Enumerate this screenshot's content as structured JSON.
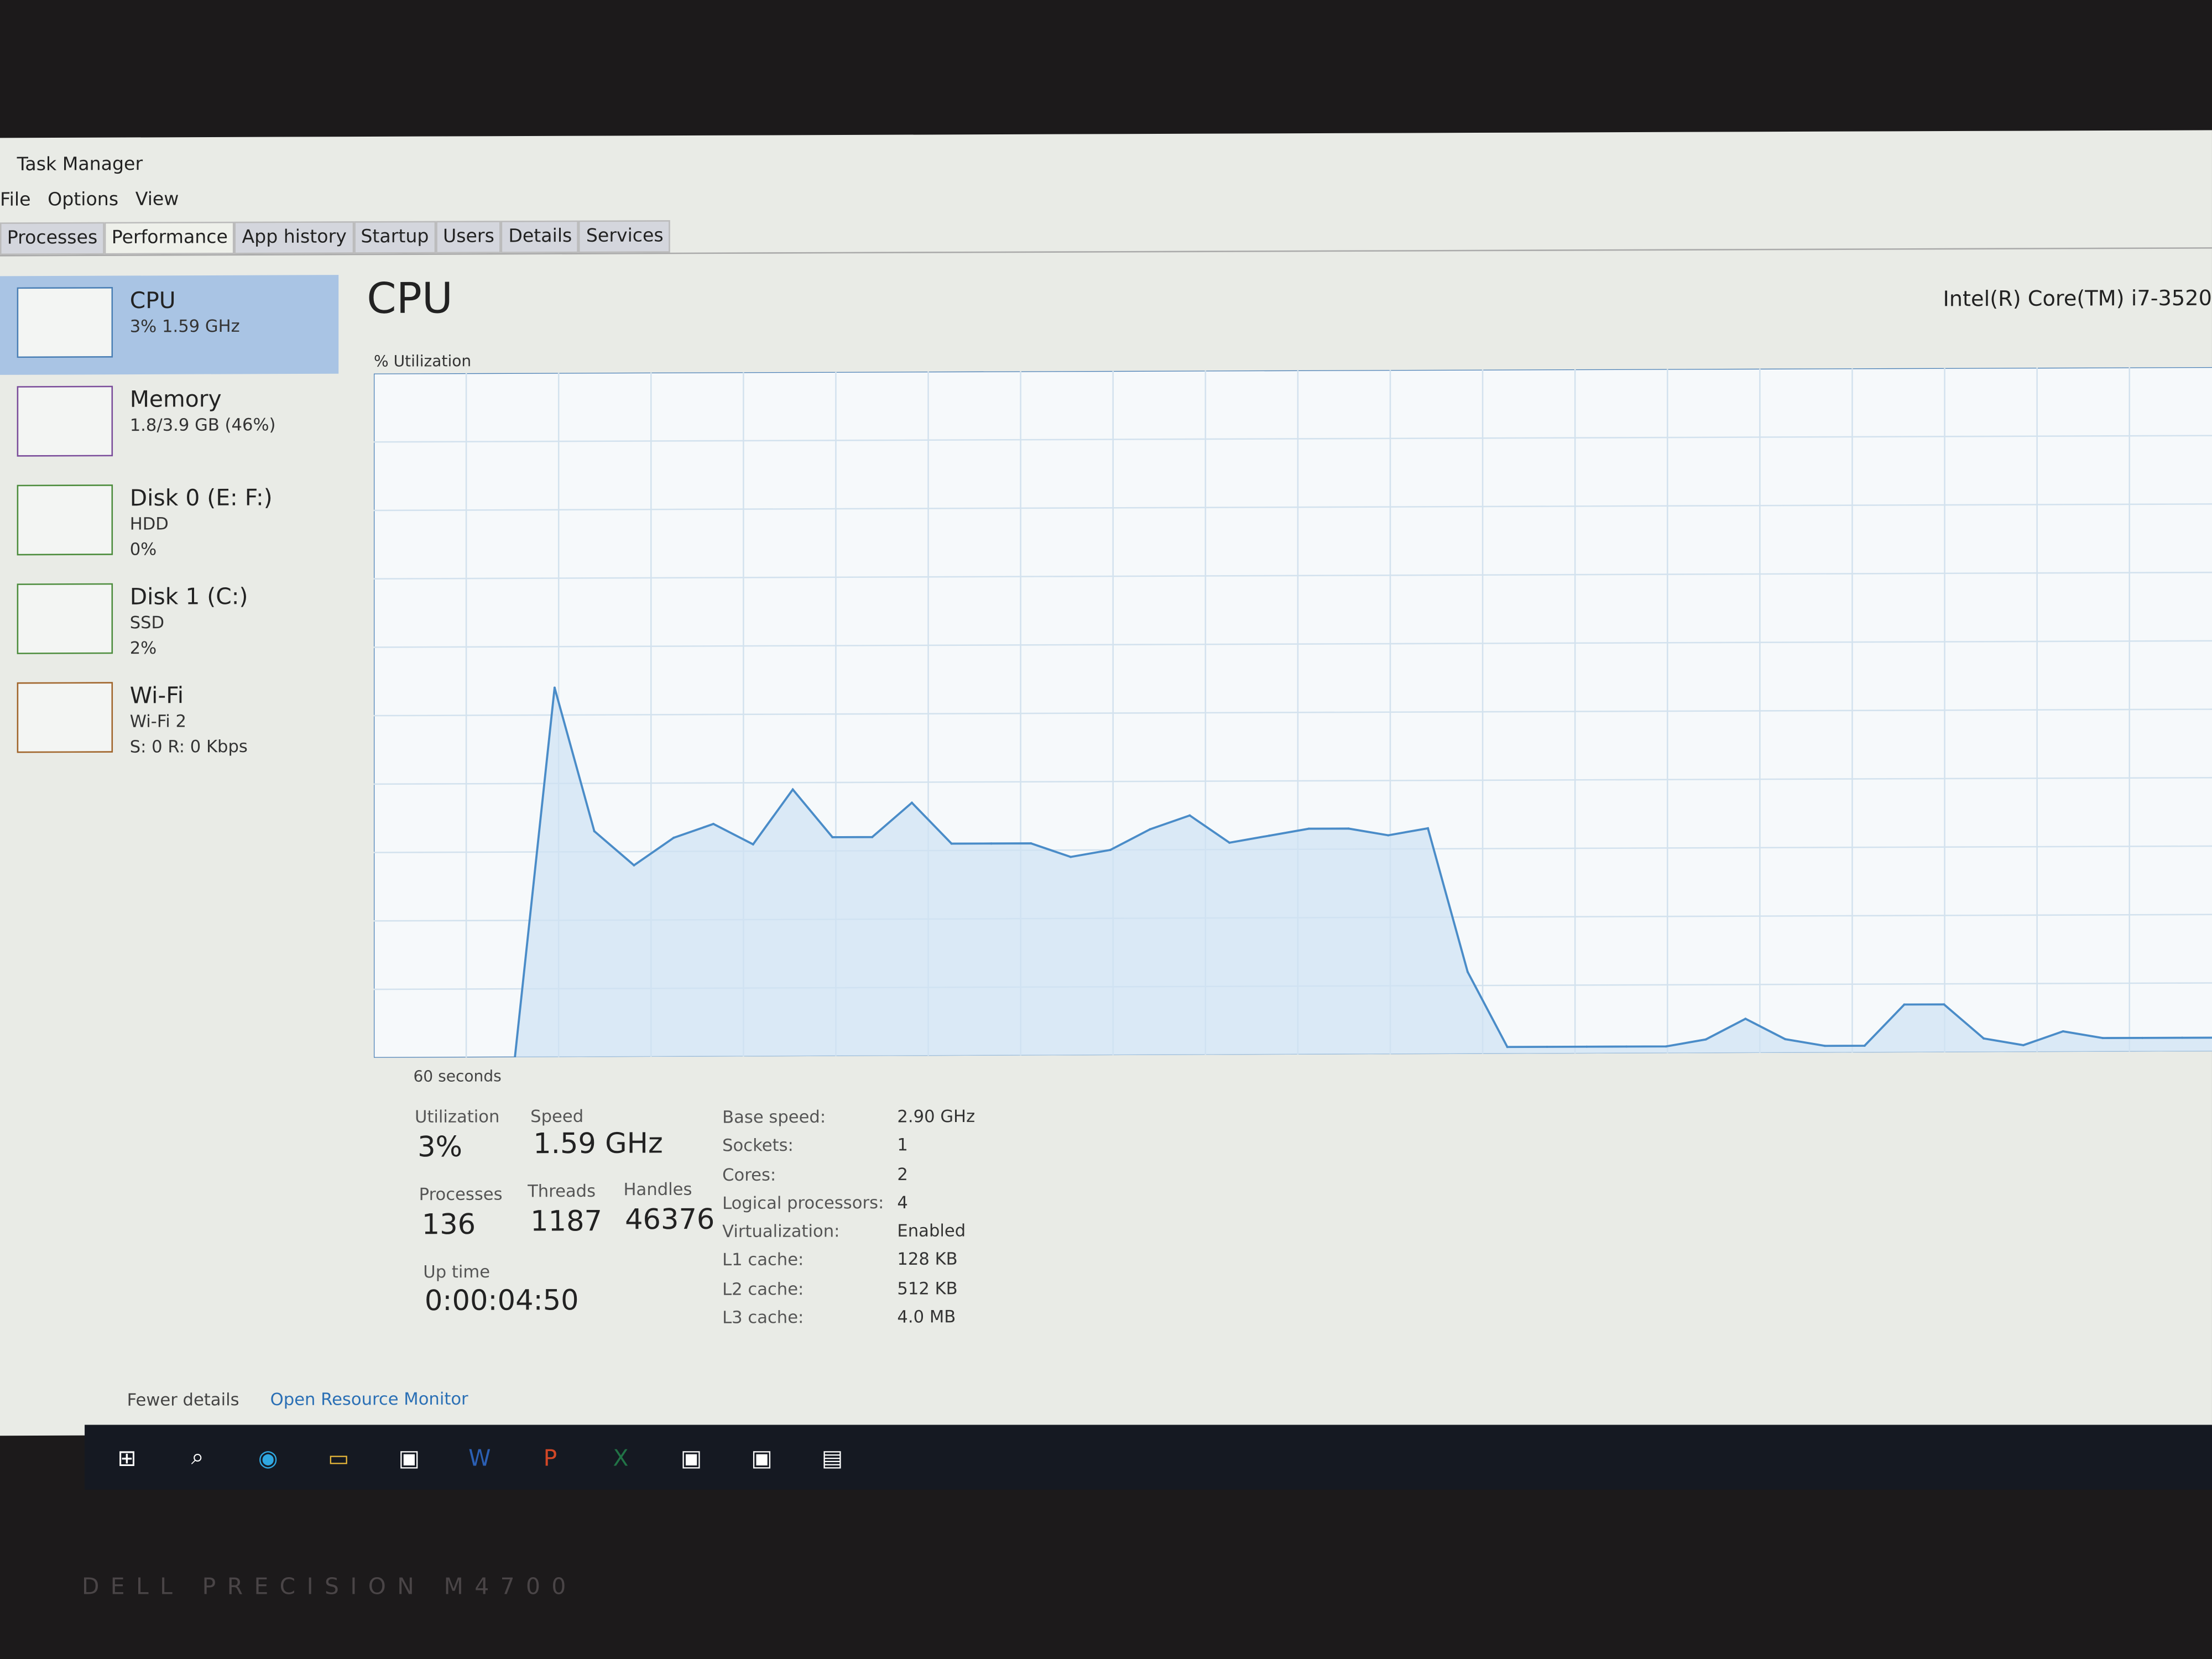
{
  "window": {
    "title": "Task Manager"
  },
  "menu": [
    "File",
    "Options",
    "View"
  ],
  "tabs": [
    "Processes",
    "Performance",
    "App history",
    "Startup",
    "Users",
    "Details",
    "Services"
  ],
  "active_tab": "Performance",
  "sidebar": [
    {
      "name": "CPU",
      "line1": "3%  1.59 GHz",
      "line2": "",
      "selected": true
    },
    {
      "name": "Memory",
      "line1": "1.8/3.9 GB (46%)",
      "line2": ""
    },
    {
      "name": "Disk 0 (E: F:)",
      "line1": "HDD",
      "line2": "0%"
    },
    {
      "name": "Disk 1 (C:)",
      "line1": "SSD",
      "line2": "2%"
    },
    {
      "name": "Wi-Fi",
      "line1": "Wi-Fi 2",
      "line2": "S: 0 R: 0 Kbps"
    }
  ],
  "main": {
    "title": "CPU",
    "model": "Intel(R) Core(TM) i7-3520",
    "graph_label": "% Utilization",
    "time_label": "60 seconds"
  },
  "chart_data": {
    "type": "area",
    "ylim": [
      0,
      100
    ],
    "xlabel": "60 seconds",
    "ylabel": "% Utilization",
    "color": "#4a8cc8",
    "values": [
      0,
      54,
      33,
      28,
      32,
      34,
      31,
      39,
      32,
      32,
      37,
      31,
      31,
      31,
      29,
      30,
      33,
      35,
      31,
      32,
      33,
      33,
      32,
      33,
      12,
      1,
      1,
      1,
      1,
      1,
      2,
      5,
      2,
      1,
      1,
      7,
      7,
      2,
      1,
      3,
      2,
      2,
      2,
      2
    ]
  },
  "stats": {
    "utilization_label": "Utilization",
    "utilization": "3%",
    "speed_label": "Speed",
    "speed": "1.59 GHz",
    "processes_label": "Processes",
    "processes": "136",
    "threads_label": "Threads",
    "threads": "1187",
    "handles_label": "Handles",
    "handles": "46376",
    "uptime_label": "Up time",
    "uptime": "0:00:04:50"
  },
  "specs": [
    [
      "Base speed:",
      "2.90 GHz"
    ],
    [
      "Sockets:",
      "1"
    ],
    [
      "Cores:",
      "2"
    ],
    [
      "Logical processors:",
      "4"
    ],
    [
      "Virtualization:",
      "Enabled"
    ],
    [
      "L1 cache:",
      "128 KB"
    ],
    [
      "L2 cache:",
      "512 KB"
    ],
    [
      "L3 cache:",
      "4.0 MB"
    ]
  ],
  "footer": {
    "fewer": "Fewer details",
    "monitor": "Open Resource Monitor"
  },
  "taskbar": [
    "windows-icon",
    "search-icon",
    "edge-icon",
    "file-explorer-icon",
    "app-icon",
    "word-icon",
    "powerpoint-icon",
    "excel-icon",
    "app-icon",
    "app-icon",
    "task-manager-icon"
  ],
  "bezel": "DELL PRECISION M4700"
}
